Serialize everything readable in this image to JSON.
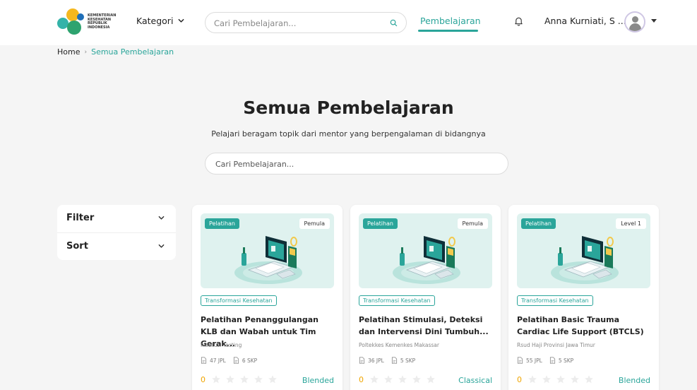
{
  "header": {
    "logo_lines": [
      "KEMENTERIAN",
      "KESEHATAN",
      "REPUBLIK",
      "INDONESIA"
    ],
    "kategori_label": "Kategori",
    "search_placeholder": "Cari Pembelajaran...",
    "nav_active_label": "Pembelajaran",
    "user_name": "Anna Kurniati, S ...",
    "accent_color": "#2aa59a"
  },
  "breadcrumb": {
    "home": "Home",
    "separator": "›",
    "current": "Semua Pembelajaran"
  },
  "hero": {
    "title": "Semua Pembelajaran",
    "subtitle": "Pelajari beragam topik dari mentor yang berpengalaman di bidangnya",
    "search_placeholder": "Cari Pembelajaran..."
  },
  "filter_panel": {
    "filter_label": "Filter",
    "sort_label": "Sort"
  },
  "cards": [
    {
      "type_badge": "Pelatihan",
      "level_badge": "Pemula",
      "tag": "Transformasi Kesehatan",
      "title": "Pelatihan Penanggulangan KLB dan Wabah untuk Tim Gerak...",
      "institution": "Institusi Testing",
      "jpl": "47 JPL",
      "skp": "6 SKP",
      "rating_value": "0",
      "method": "Blended"
    },
    {
      "type_badge": "Pelatihan",
      "level_badge": "Pemula",
      "tag": "Transformasi Kesehatan",
      "title": "Pelatihan Stimulasi, Deteksi dan Intervensi Dini Tumbuh...",
      "institution": "Poltekkes Kemenkes Makassar",
      "jpl": "36 JPL",
      "skp": "5 SKP",
      "rating_value": "0",
      "method": "Classical"
    },
    {
      "type_badge": "Pelatihan",
      "level_badge": "Level 1",
      "tag": "Transformasi Kesehatan",
      "title": "Pelatihan Basic Trauma Cardiac Life Support (BTCLS)",
      "institution": "Rsud Haji Provinsi Jawa Timur",
      "jpl": "55 JPL",
      "skp": "5 SKP",
      "rating_value": "0",
      "method": "Blended"
    }
  ]
}
